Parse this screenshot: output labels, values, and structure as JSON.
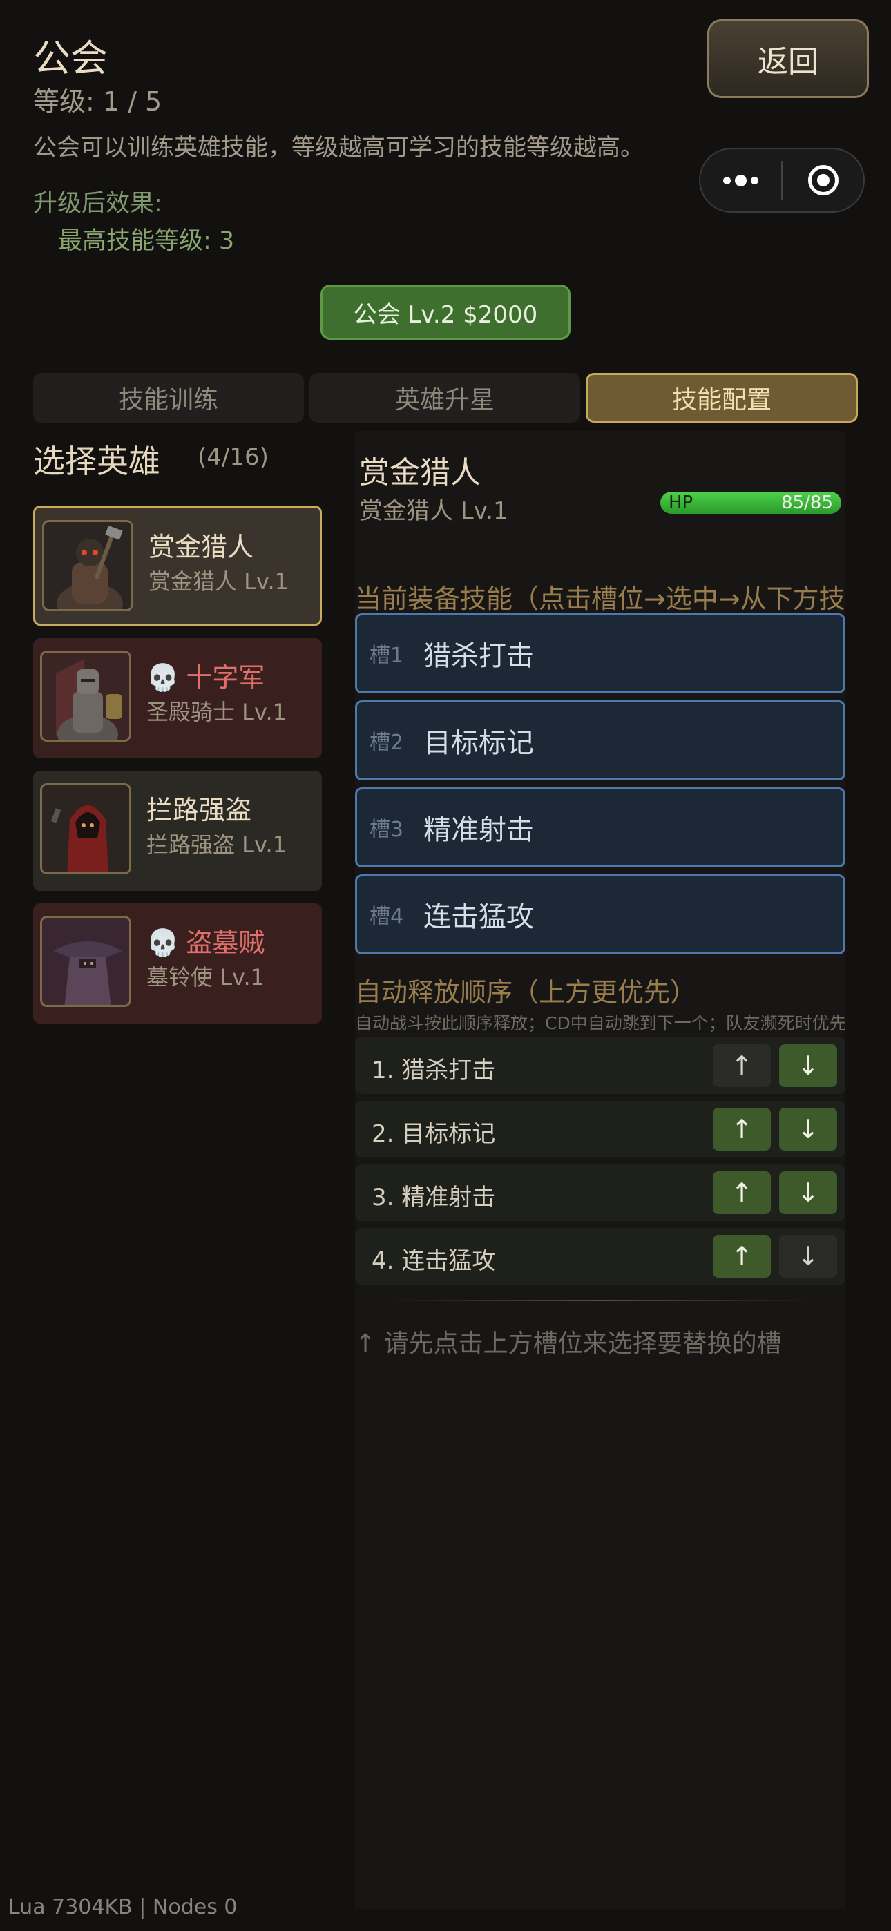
{
  "header": {
    "title": "公会",
    "level": "等级: 1 / 5",
    "description": "公会可以训练英雄技能，等级越高可学习的技能等级越高。",
    "effect_label": "升级后效果:",
    "effect_value": "最高技能等级: 3",
    "back_label": "返回",
    "upgrade_label": "公会 Lv.2 $2000"
  },
  "tabs": [
    {
      "label": "技能训练",
      "active": false
    },
    {
      "label": "英雄升星",
      "active": false
    },
    {
      "label": "技能配置",
      "active": true
    }
  ],
  "hero_select": {
    "title": "选择英雄",
    "count": "(4/16)",
    "heroes": [
      {
        "name": "赏金猎人",
        "sub": "赏金猎人 Lv.1",
        "dead": false,
        "selected": true
      },
      {
        "name": "十字军",
        "sub": "圣殿骑士 Lv.1",
        "dead": true,
        "selected": false
      },
      {
        "name": "拦路强盗",
        "sub": "拦路强盗 Lv.1",
        "dead": false,
        "selected": false
      },
      {
        "name": "盗墓贼",
        "sub": "墓铃使 Lv.1",
        "dead": true,
        "selected": false
      }
    ]
  },
  "detail": {
    "hero_name": "赏金猎人",
    "hero_sub": "赏金猎人 Lv.1",
    "hp_label": "HP",
    "hp_value": "85/85",
    "hp_fraction": 1.0,
    "equipped_label": "当前装备技能（点击槽位→选中→从下方技能列表替换）",
    "slots": [
      {
        "no": "槽1",
        "name": "猎杀打击"
      },
      {
        "no": "槽2",
        "name": "目标标记"
      },
      {
        "no": "槽3",
        "name": "精准射击"
      },
      {
        "no": "槽4",
        "name": "连击猛攻"
      }
    ],
    "order_title": "自动释放顺序（上方更优先）",
    "order_hint": "自动战斗按此顺序释放；CD中自动跳到下一个；队友濒死时优先治疗",
    "order": [
      {
        "text": "1. 猎杀打击",
        "up_enabled": false,
        "down_enabled": true
      },
      {
        "text": "2. 目标标记",
        "up_enabled": true,
        "down_enabled": true
      },
      {
        "text": "3. 精准射击",
        "up_enabled": true,
        "down_enabled": true
      },
      {
        "text": "4. 连击猛攻",
        "up_enabled": true,
        "down_enabled": false
      }
    ],
    "up_arrow": "↑",
    "down_arrow": "↓",
    "replace_hint": "↑ 请先点击上方槽位来选择要替换的槽"
  },
  "footer": "Lua 7304KB | Nodes 0",
  "colors": {
    "background": "#121110",
    "accent_gold": "#c9ab5c",
    "upgrade_green": "#3f6f2e",
    "slot_blue": "#4f79ad",
    "dead_red": "#e2706a"
  }
}
